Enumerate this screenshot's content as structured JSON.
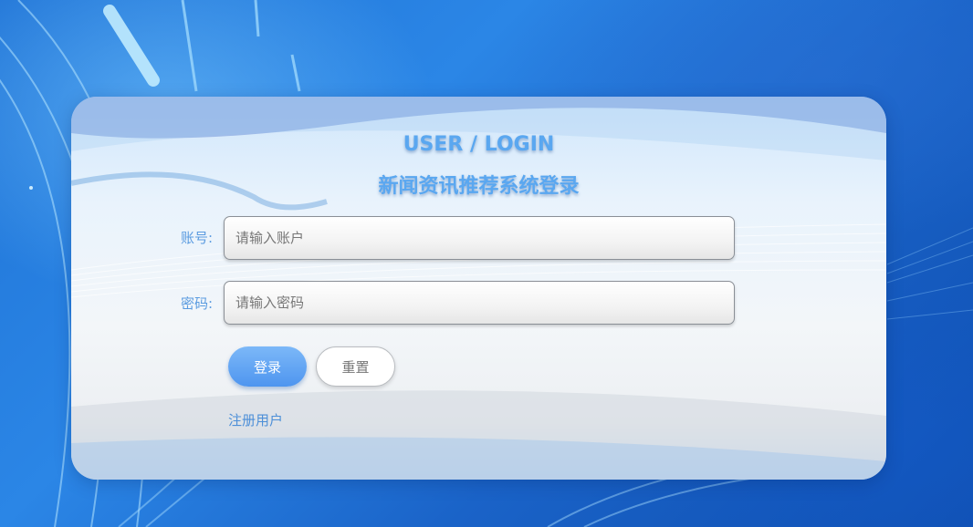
{
  "title_en": "USER / LOGIN",
  "title_cn": "新闻资讯推荐系统登录",
  "account": {
    "label": "账号:",
    "placeholder": "请输入账户",
    "value": ""
  },
  "password": {
    "label": "密码:",
    "placeholder": "请输入密码",
    "value": ""
  },
  "buttons": {
    "login": "登录",
    "reset": "重置"
  },
  "register_link": "注册用户",
  "colors": {
    "accent": "#5aa7f0",
    "login_button": "#5b9ff2",
    "link": "#4d8fd8",
    "background": "#1f73d6"
  }
}
